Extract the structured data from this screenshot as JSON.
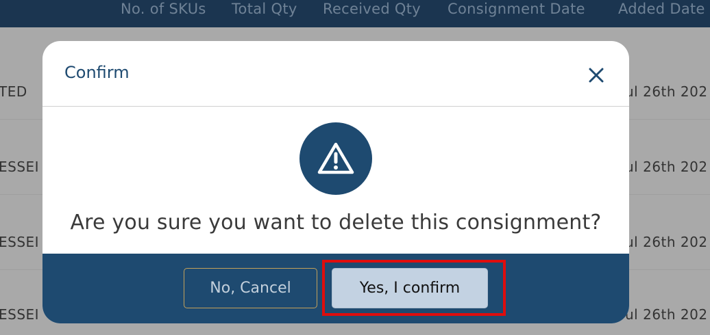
{
  "table": {
    "headers": [
      "No. of SKUs",
      "Total Qty",
      "Received Qty",
      "Consignment Date",
      "Added Date"
    ],
    "rows": [
      {
        "status": "TED",
        "date": "ul 26th 202"
      },
      {
        "status": "ESSEI",
        "date": "ul 26th 202"
      },
      {
        "status": "ESSEI",
        "date": "ul 26th 202"
      },
      {
        "status": "ESSEI",
        "date": "ul 26th 202"
      }
    ]
  },
  "modal": {
    "title": "Confirm",
    "close_icon": "close-icon",
    "warning_icon": "warning-triangle-icon",
    "message": "Are you sure you want to delete this consignment?",
    "cancel_label": "No, Cancel",
    "confirm_label": "Yes, I confirm"
  },
  "colors": {
    "primary": "#1e4a70",
    "header_bg": "#1b3550",
    "overlay_bg": "#a9a9a9",
    "highlight": "#e00d0d"
  }
}
